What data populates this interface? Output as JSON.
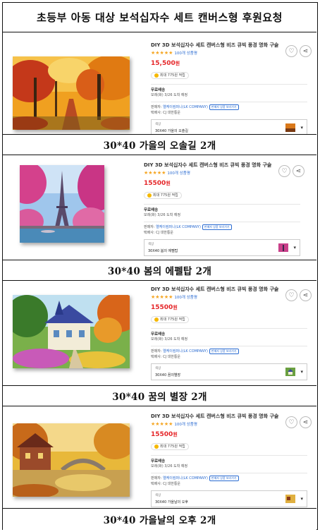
{
  "header": {
    "title": "초등부 아동 대상 보석십자수 세트 캔버스형 후원요청"
  },
  "products": [
    {
      "name": "DIY 3D 보석십자수 세트 캔버스형 비즈 큐빅 풍경 명화 구술",
      "stars": "★★★★★",
      "reviews": "100개 상품평",
      "price": "15,500",
      "won": "원",
      "reward": "최대 775원 적립",
      "shipping_title": "무료배송",
      "delivery": "모레(화) 3/26 도착 예정",
      "seller_label": "판매자:",
      "seller": "엘케이컴퍼니(LK COMPANY)",
      "seller_tag": "판매자 상품 보러가기",
      "courier": "택배사: CJ 대한통운",
      "option_label": "색상",
      "option_value": "30X40 가을의 오솔길",
      "caption": "30*40 가을의 오솔길 2개"
    },
    {
      "name": "DIY 3D 보석십자수 세트 캔버스형 비즈 큐빅 풍경 명화 구술",
      "stars": "★★★★★",
      "reviews": "100개 상품평",
      "price": "15500",
      "won": "원",
      "reward": "최대 775원 적립",
      "shipping_title": "무료배송",
      "delivery": "모레(화) 3/26 도착 예정",
      "seller_label": "판매자:",
      "seller": "엘케이컴퍼니(LK COMPANY)",
      "seller_tag": "판매자 상품 보러가기",
      "courier": "택배사: CJ 대한통운",
      "option_label": "색상",
      "option_value": "30X40 봄의 에펠탑",
      "caption": "30*40 봄의 에펠탑 2개"
    },
    {
      "name": "DIY 3D 보석십자수 세트 캔버스형 비즈 큐빅 풍경 명화 구술",
      "stars": "★★★★★",
      "reviews": "100개 상품평",
      "price": "15500",
      "won": "원",
      "reward": "최대 775원 적립",
      "shipping_title": "무료배송",
      "delivery": "모레(화) 3/26 도착 예정",
      "seller_label": "판매자:",
      "seller": "엘케이컴퍼니(LK COMPANY)",
      "seller_tag": "판매자 상품 보러가기",
      "courier": "택배사: CJ 대한통운",
      "option_label": "색상",
      "option_value": "30X40 꿈의별장",
      "caption": "30*40 꿈의 별장 2개"
    },
    {
      "name": "DIY 3D 보석십자수 세트 캔버스형 비즈 큐빅 풍경 명화 구술",
      "stars": "★★★★★",
      "reviews": "100개 상품평",
      "price": "15500",
      "won": "원",
      "reward": "최대 775원 적립",
      "shipping_title": "무료배송",
      "delivery": "모레(화) 3/26 도착 예정",
      "seller_label": "판매자:",
      "seller": "엘케이컴퍼니(LK COMPANY)",
      "seller_tag": "판매자 상품 보러가기",
      "courier": "택배사: CJ 대한통운",
      "option_label": "색상",
      "option_value": "30X40 가을날의 오후",
      "caption": "30*40 가을날의 오후 2개"
    }
  ],
  "icons": {
    "wishlist": "heart-icon",
    "share": "share-icon",
    "dropdown": "chevron-down-icon",
    "reward": "coin-icon"
  },
  "colors": {
    "price": "#e52528",
    "link": "#2a6bd1",
    "star": "#f5a623"
  }
}
